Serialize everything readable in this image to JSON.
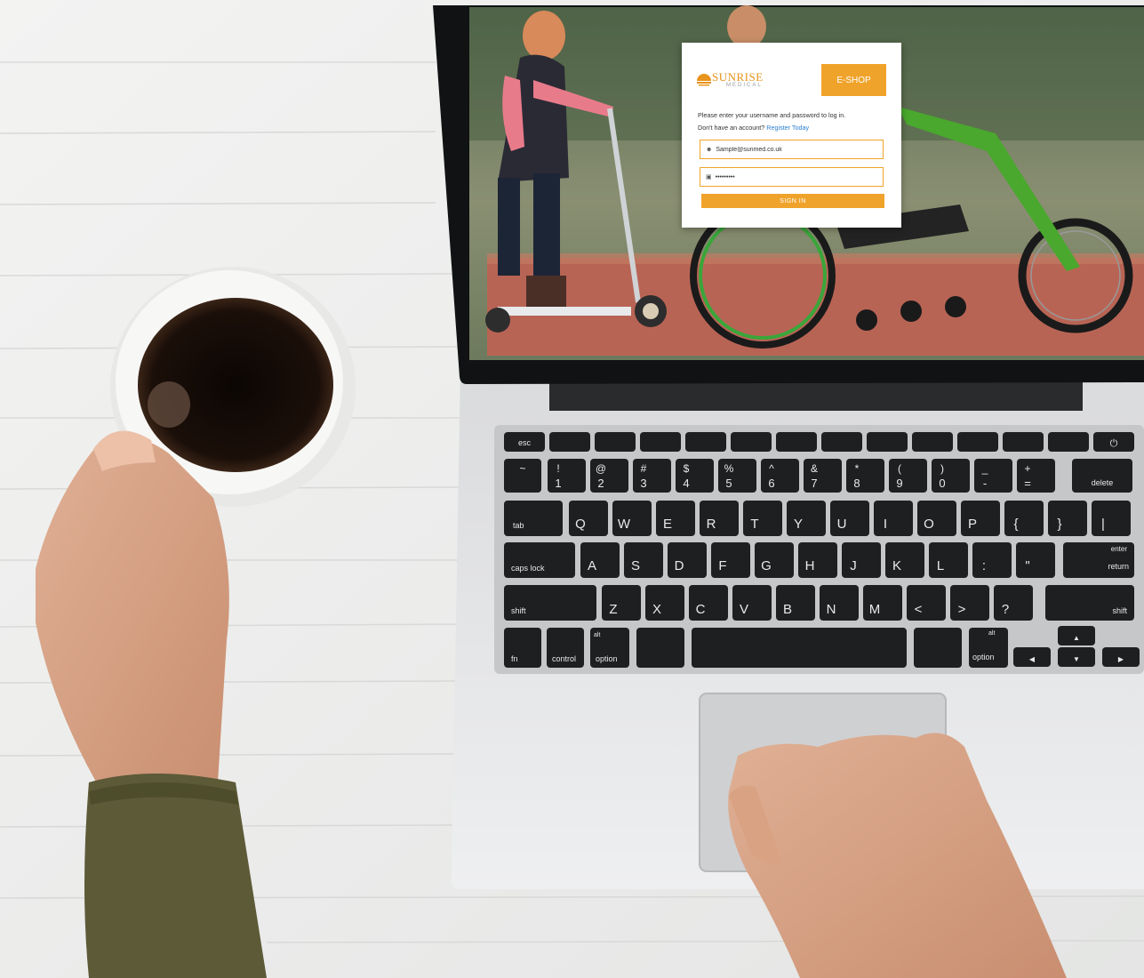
{
  "login": {
    "brand": "SUNRISE",
    "brand_sub": "MEDICAL",
    "eshop_label": "E-SHOP",
    "message": "Please enter your username and password to log in.",
    "no_account": "Don't have an account?",
    "register_label": "Register Today",
    "username_value": "Sample@sunmed.co.uk",
    "password_value": "•••••••••",
    "signin_label": "SIGN IN",
    "icons": {
      "user": "user-icon",
      "lock": "lock-icon"
    },
    "accent_color": "#f0a32b",
    "link_color": "#2a7fd0"
  },
  "keyboard": {
    "esc": "esc",
    "delete": "delete",
    "tab": "tab",
    "caps": "caps lock",
    "enter": "enter",
    "return": "return",
    "shift": "shift",
    "fn": "fn",
    "control": "control",
    "alt": "alt",
    "option": "option",
    "row1": [
      "~",
      "!",
      "@",
      "#",
      "$",
      "%",
      "^",
      "&",
      "*",
      "(",
      ")",
      "_",
      "+"
    ],
    "row1_low": [
      "`",
      "1",
      "2",
      "3",
      "4",
      "5",
      "6",
      "7",
      "8",
      "9",
      "0",
      "-",
      "="
    ],
    "row2": [
      "Q",
      "W",
      "E",
      "R",
      "T",
      "Y",
      "U",
      "I",
      "O",
      "P",
      "{",
      "}",
      "|"
    ],
    "row3": [
      "A",
      "S",
      "D",
      "F",
      "G",
      "H",
      "J",
      "K",
      "L",
      ":",
      "\""
    ],
    "row4": [
      "Z",
      "X",
      "C",
      "V",
      "B",
      "N",
      "M",
      "<",
      ">",
      "?"
    ]
  }
}
